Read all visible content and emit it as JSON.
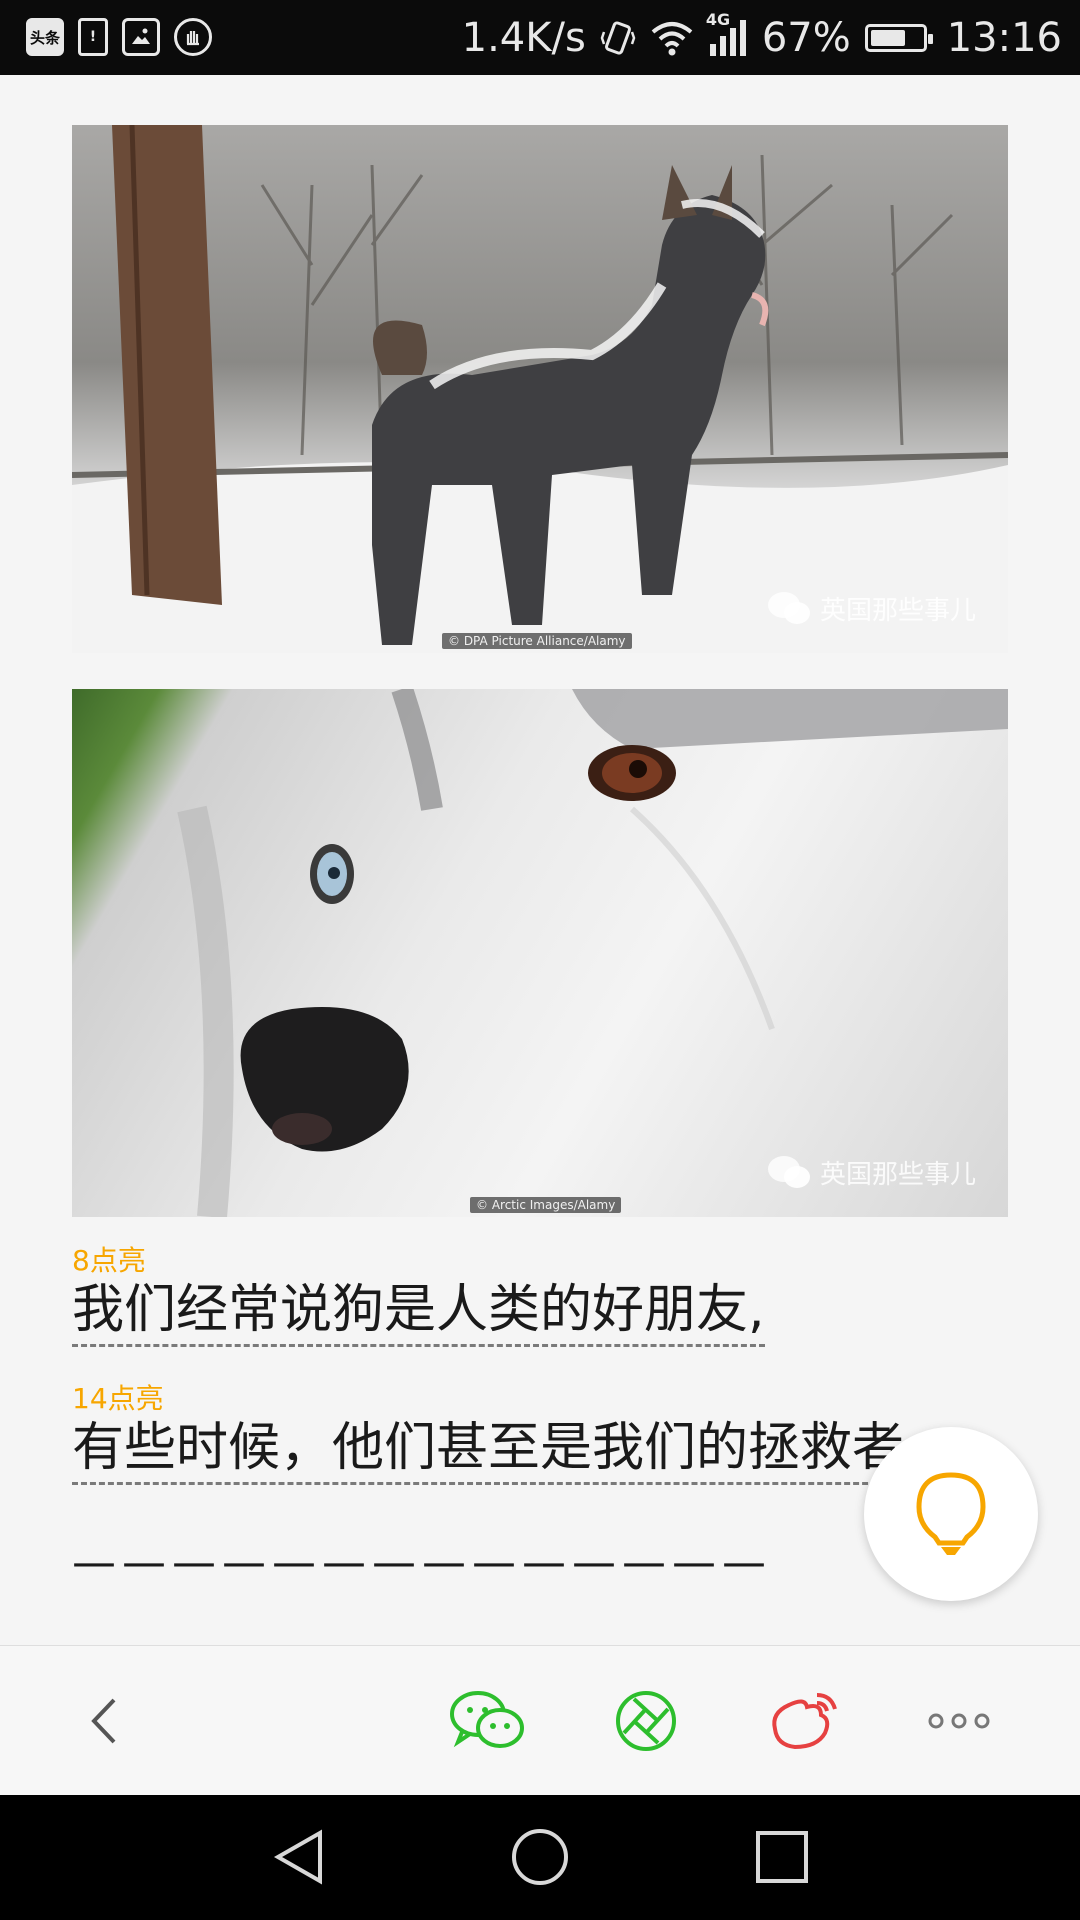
{
  "status_bar": {
    "left_icons": [
      "toutiao-app-icon",
      "battery-saver-icon",
      "image-icon",
      "hand-icon"
    ],
    "toutiao_label": "头条",
    "network_speed": "1.4K/s",
    "network_type": "4G",
    "battery_percent": "67%",
    "battery_level": 0.67,
    "time": "13:16"
  },
  "article": {
    "images": [
      {
        "credit": "© DPA Picture Alliance/Alamy",
        "watermark": "英国那些事儿"
      },
      {
        "credit": "© Arctic Images/Alamy",
        "watermark": "英国那些事儿"
      }
    ],
    "paragraphs": [
      {
        "highlight_count": "8点亮",
        "text": "我们经常说狗是人类的好朋友,"
      },
      {
        "highlight_count": "14点亮",
        "text": "有些时候，他们甚至是我们的拯救者"
      }
    ],
    "divider": "——————————————"
  },
  "fab": {
    "icon": "lightbulb-icon",
    "color": "#f7a600"
  },
  "toolbar": {
    "items": [
      "back-icon",
      "wechat-icon",
      "moments-icon",
      "weibo-icon",
      "more-icon"
    ],
    "wechat_color": "#2dbe2d",
    "weibo_color": "#e64141"
  },
  "nav_bar": {
    "items": [
      "nav-back-icon",
      "nav-home-icon",
      "nav-recents-icon"
    ]
  }
}
